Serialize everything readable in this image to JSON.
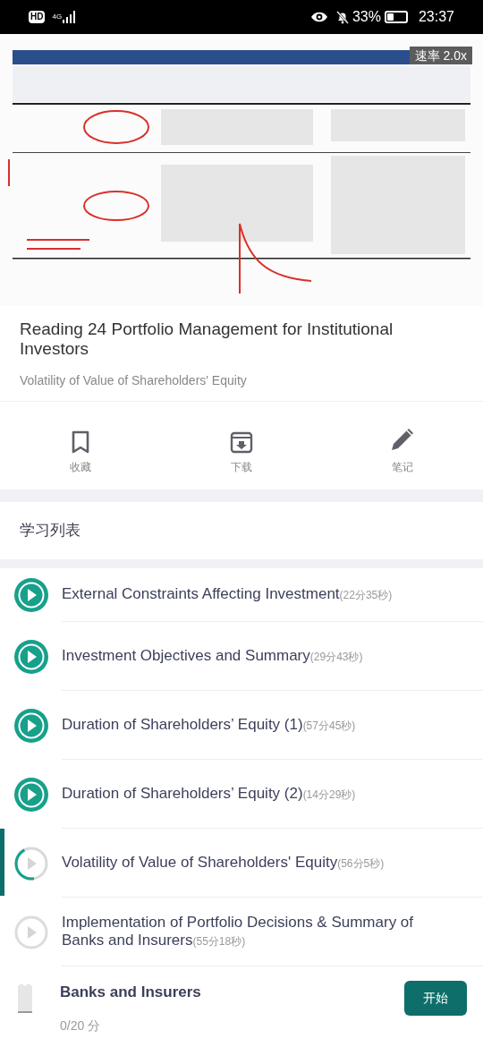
{
  "status_bar": {
    "hd": "HD",
    "network": "4G",
    "battery": "33%",
    "time": "23:37"
  },
  "video": {
    "speed": "速率 2.0x"
  },
  "course": {
    "title": "Reading 24 Portfolio Management for Institutional Investors",
    "subtitle": "Volatility of Value of Shareholders' Equity"
  },
  "actions": [
    {
      "kind": "bookmark",
      "label": "收藏"
    },
    {
      "kind": "download",
      "label": "下载"
    },
    {
      "kind": "note",
      "label": "笔记"
    }
  ],
  "section_title": "学习列表",
  "lessons": [
    {
      "title": "External Constraints Affecting Investment",
      "duration": "(22分35秒)",
      "kind": "done",
      "selected": false
    },
    {
      "title": "Investment Objectives and Summary",
      "duration": "(29分43秒)",
      "kind": "done",
      "selected": false
    },
    {
      "title": "Duration of Shareholders’ Equity (1)",
      "duration": "(57分45秒)",
      "kind": "done",
      "selected": false
    },
    {
      "title": "Duration of Shareholders’ Equity (2)",
      "duration": "(14分29秒)",
      "kind": "done",
      "selected": false
    },
    {
      "title": "Volatility of Value of Shareholders' Equity",
      "duration": "(56分5秒)",
      "kind": "partial",
      "level": 0.45,
      "selected": true
    },
    {
      "title": "Implementation of Portfolio Decisions & Summary of Banks and Insurers",
      "duration": "(55分18秒)",
      "kind": "new",
      "selected": false
    }
  ],
  "quiz": {
    "title": "Banks and Insurers",
    "score": "0/20 分",
    "button": "开始"
  }
}
